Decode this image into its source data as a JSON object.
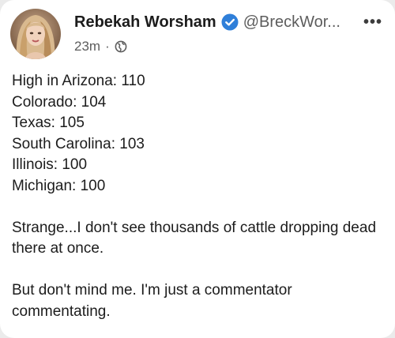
{
  "post": {
    "author": {
      "display_name": "Rebekah Worsham",
      "handle": "@BreckWor...",
      "verified": true,
      "avatar_icon": "user-avatar-photo"
    },
    "meta": {
      "time": "23m",
      "separator": "·",
      "audience_icon": "globe-icon"
    },
    "more_icon": "more-options-icon",
    "more_label": "•••",
    "lines": [
      "High in Arizona: 110",
      "Colorado: 104",
      "Texas: 105",
      "South Carolina: 103",
      "Illinois: 100",
      "Michigan: 100"
    ],
    "paragraph_2": "Strange...I don't see thousands of cattle dropping dead there at once.",
    "paragraph_3": "But don't mind me. I'm just a commentator commentating."
  },
  "colors": {
    "verified_badge": "#1d9bf0",
    "text_primary": "#1c1c1c",
    "text_secondary": "#5d5d5d"
  }
}
